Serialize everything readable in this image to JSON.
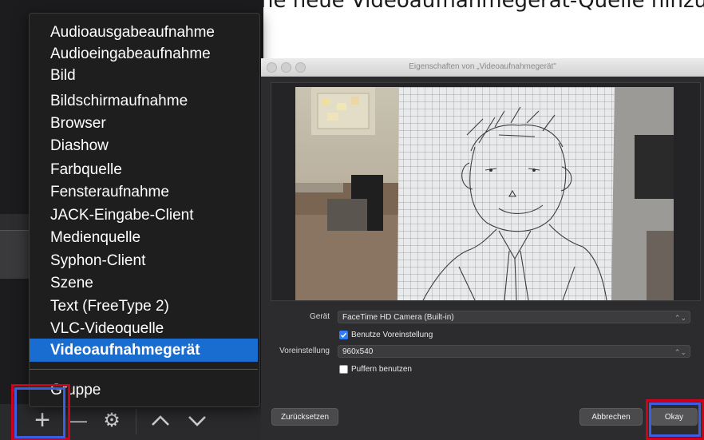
{
  "top_text": "ge  eine  neue  Videoaufnahmegerät-Quelle  hinzu",
  "menu": {
    "items": [
      "Audioausgabeaufnahme",
      "Audioeingabeaufnahme",
      "Bild",
      "Bildschirmaufnahme",
      "Browser",
      "Diashow",
      "Farbquelle",
      "Fensteraufnahme",
      "JACK-Eingabe-Client",
      "Medienquelle",
      "Syphon-Client",
      "Szene",
      "Text (FreeType 2)",
      "VLC-Videoquelle",
      "Videoaufnahmegerät"
    ],
    "selected": "Videoaufnahmegerät",
    "group_item": "Gruppe"
  },
  "toolbar": {
    "add": "+",
    "remove": "—",
    "settings": "⚙",
    "up": "⌃",
    "down": "⌄"
  },
  "props": {
    "title": "Eigenschaften von „Videoaufnahmegerät\"",
    "device_label": "Gerät",
    "device_value": "FaceTime HD Camera (Built-in)",
    "use_preset_label": "Benutze Voreinstellung",
    "use_preset_checked": true,
    "preset_label": "Voreinstellung",
    "preset_value": "960x540",
    "buffering_label": "Puffern benutzen",
    "buffering_checked": false,
    "reset_button": "Zurücksetzen",
    "cancel_button": "Abbrechen",
    "ok_button": "Okay"
  },
  "colors": {
    "menu_selection": "#1a6dd0",
    "highlight_red": "#d0021b",
    "highlight_blue": "#3b5fe0",
    "checkbox_checked": "#2f7cf6"
  }
}
